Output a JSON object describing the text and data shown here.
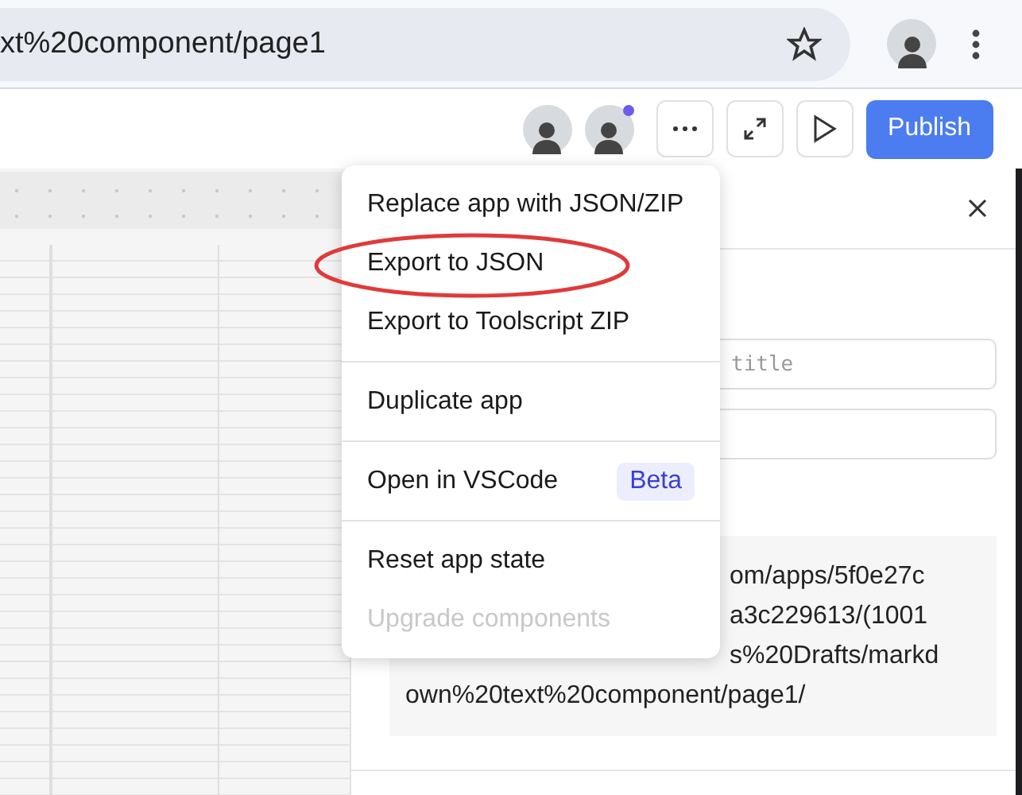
{
  "browser": {
    "url": "xt%20component/page1"
  },
  "toolbar": {
    "collaborators": [
      {
        "online": false
      },
      {
        "online": true
      }
    ],
    "publish_label": "Publish"
  },
  "panel": {
    "title_placeholder": "title",
    "code_lines": [
      "om/apps/5f0e27c",
      "a3c229613/(1001",
      "s%20Drafts/markd",
      "own%20text%20component/page1/"
    ]
  },
  "menu": {
    "groups": [
      [
        {
          "label": "Replace app with JSON/ZIP",
          "disabled": false,
          "circled": false
        },
        {
          "label": "Export to JSON",
          "disabled": false,
          "circled": true
        },
        {
          "label": "Export to Toolscript ZIP",
          "disabled": false,
          "circled": false
        }
      ],
      [
        {
          "label": "Duplicate app",
          "disabled": false,
          "circled": false
        }
      ],
      [
        {
          "label": "Open in VSCode",
          "badge": "Beta",
          "disabled": false,
          "circled": false
        }
      ],
      [
        {
          "label": "Reset app state",
          "disabled": false,
          "circled": false
        },
        {
          "label": "Upgrade components",
          "disabled": true,
          "circled": false
        }
      ]
    ]
  }
}
